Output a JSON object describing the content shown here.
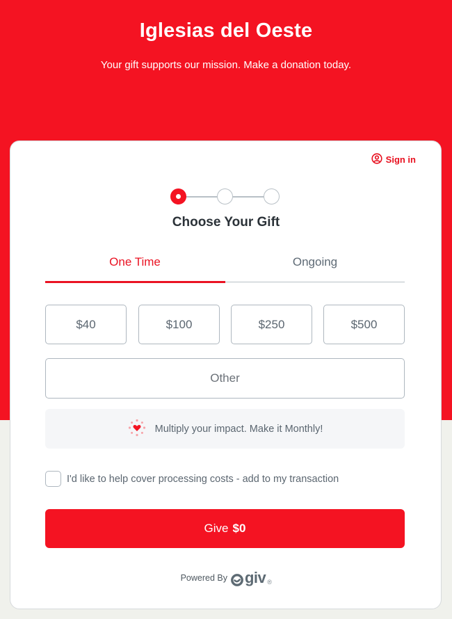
{
  "header": {
    "title": "Iglesias del Oeste",
    "subtitle": "Your gift supports our mission. Make a donation today."
  },
  "account": {
    "sign_in_label": "Sign in",
    "icon": "user-circle-icon"
  },
  "stepper": {
    "total_steps": 3,
    "current_step": 1,
    "title": "Choose Your Gift"
  },
  "tabs": [
    {
      "label": "One Time",
      "active": true
    },
    {
      "label": "Ongoing",
      "active": false
    }
  ],
  "amounts": [
    "$40",
    "$100",
    "$250",
    "$500"
  ],
  "other_label": "Other",
  "promo": {
    "icon": "heart-sparkle-icon",
    "text": "Multiply your impact. Make it Monthly!"
  },
  "fee_cover": {
    "label": "I'd like to help cover processing costs - add to my transaction",
    "checked": false
  },
  "give_button": {
    "prefix": "Give",
    "amount": "$0"
  },
  "footer": {
    "powered_by": "Powered By",
    "brand": "giv",
    "registered": "®"
  },
  "colors": {
    "brand_red": "#f41322",
    "text_gray": "#5b6670",
    "border_gray": "#aeb7bf",
    "page_bg": "#f0f1ec"
  }
}
